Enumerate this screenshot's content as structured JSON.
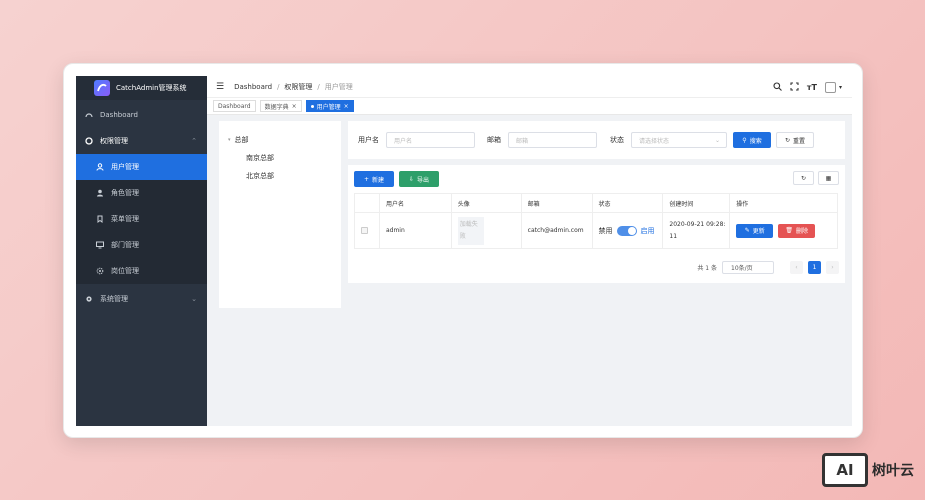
{
  "app": {
    "title": "CatchAdmin管理系统"
  },
  "sidebar": {
    "items": [
      {
        "label": "Dashboard",
        "icon": "dashboard-icon"
      },
      {
        "label": "权限管理",
        "icon": "settings-circle-icon",
        "expanded": true
      },
      {
        "label": "用户管理",
        "icon": "user-icon",
        "active": true
      },
      {
        "label": "角色管理",
        "icon": "user-role-icon"
      },
      {
        "label": "菜单管理",
        "icon": "bookmark-icon"
      },
      {
        "label": "部门管理",
        "icon": "monitor-icon"
      },
      {
        "label": "岗位管理",
        "icon": "gear-icon"
      },
      {
        "label": "系统管理",
        "icon": "cog-icon"
      }
    ]
  },
  "breadcrumb": {
    "home": "Dashboard",
    "parent": "权限管理",
    "current": "用户管理"
  },
  "tabs": [
    {
      "label": "Dashboard",
      "closable": false
    },
    {
      "label": "数据字典",
      "closable": true
    },
    {
      "label": "用户管理",
      "closable": true,
      "active": true
    }
  ],
  "tree": {
    "root": "总部",
    "children": [
      "南京总部",
      "北京总部"
    ]
  },
  "search": {
    "username_label": "用户名",
    "username_placeholder": "用户名",
    "email_label": "邮箱",
    "email_placeholder": "邮箱",
    "status_label": "状态",
    "status_placeholder": "请选择状态",
    "search_btn": "搜索",
    "reset_btn": "重置"
  },
  "toolbar": {
    "new_btn": "新建",
    "export_btn": "导出"
  },
  "table": {
    "headers": [
      "用户名",
      "头像",
      "邮箱",
      "状态",
      "创建时间",
      "操作"
    ],
    "rows": [
      {
        "username": "admin",
        "avatar_text": "加载失败",
        "email": "catch@admin.com",
        "status_off": "禁用",
        "status_on": "启用",
        "created_at": "2020-09-21 09:28:11",
        "edit_btn": "更新",
        "delete_btn": "删除"
      }
    ]
  },
  "pagination": {
    "total": "共 1 条",
    "page_size": "10条/页",
    "current_page": "1"
  },
  "watermark": {
    "logo_text": "AI",
    "brand": "树叶云"
  },
  "colors": {
    "primary": "#1f6fe0",
    "sidebar": "#2b3441",
    "success": "#2e9f6a",
    "danger": "#e55353"
  }
}
